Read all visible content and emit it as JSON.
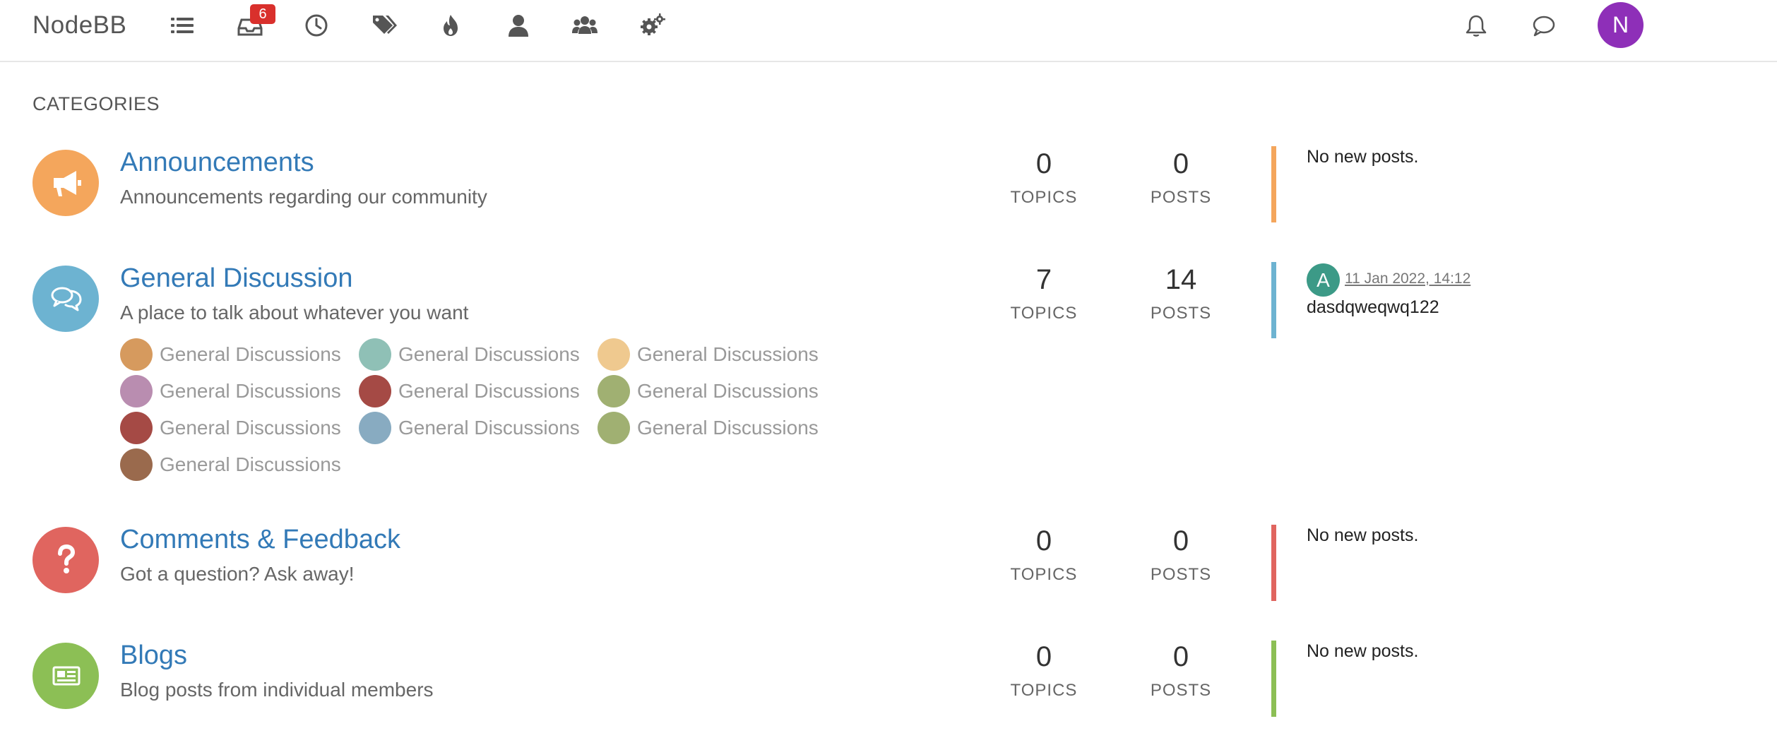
{
  "brand": "NodeBB",
  "nav": {
    "unread_badge": "6",
    "items": [
      {
        "name": "categories",
        "icon": "list-icon"
      },
      {
        "name": "unread",
        "icon": "inbox-icon"
      },
      {
        "name": "recent",
        "icon": "clock-icon"
      },
      {
        "name": "tags",
        "icon": "tags-icon"
      },
      {
        "name": "popular",
        "icon": "fire-icon"
      },
      {
        "name": "users",
        "icon": "user-icon"
      },
      {
        "name": "groups",
        "icon": "group-icon"
      },
      {
        "name": "admin",
        "icon": "gears-icon"
      }
    ]
  },
  "user": {
    "avatar_letter": "N",
    "avatar_color": "#8e2fb8"
  },
  "section_title": "CATEGORIES",
  "categories": [
    {
      "title": "Announcements",
      "description": "Announcements regarding our community",
      "topics": "0",
      "posts": "0",
      "topics_label": "TOPICS",
      "posts_label": "POSTS",
      "color": "#f4a65c",
      "icon": "bullhorn-icon",
      "last_post": "No new posts."
    },
    {
      "title": "General Discussion",
      "description": "A place to talk about whatever you want",
      "topics": "7",
      "posts": "14",
      "topics_label": "TOPICS",
      "posts_label": "POSTS",
      "color": "#6db3d1",
      "icon": "comments-icon",
      "last_post": {
        "avatar_letter": "A",
        "avatar_color": "#3c9a87",
        "time": "11 Jan 2022, 14:12",
        "text": "dasdqweqwq122"
      },
      "subcategories": [
        {
          "label": "General Discussions",
          "color": "#d69a5e"
        },
        {
          "label": "General Discussions",
          "color": "#8fc0b6"
        },
        {
          "label": "General Discussions",
          "color": "#efc98f"
        },
        {
          "label": "General Discussions",
          "color": "#b98db0"
        },
        {
          "label": "General Discussions",
          "color": "#a54a45"
        },
        {
          "label": "General Discussions",
          "color": "#a0b072"
        },
        {
          "label": "General Discussions",
          "color": "#a54a45"
        },
        {
          "label": "General Discussions",
          "color": "#88abc1"
        },
        {
          "label": "General Discussions",
          "color": "#a0b072"
        },
        {
          "label": "General Discussions",
          "color": "#9a6a4d"
        }
      ]
    },
    {
      "title": "Comments & Feedback",
      "description": "Got a question? Ask away!",
      "topics": "0",
      "posts": "0",
      "topics_label": "TOPICS",
      "posts_label": "POSTS",
      "color": "#e0655f",
      "icon": "question-icon",
      "last_post": "No new posts."
    },
    {
      "title": "Blogs",
      "description": "Blog posts from individual members",
      "topics": "0",
      "posts": "0",
      "topics_label": "TOPICS",
      "posts_label": "POSTS",
      "color": "#8cbf55",
      "icon": "newspaper-icon",
      "last_post": "No new posts."
    }
  ],
  "header_right": {
    "icons": [
      "bell-icon",
      "chat-icon"
    ]
  }
}
